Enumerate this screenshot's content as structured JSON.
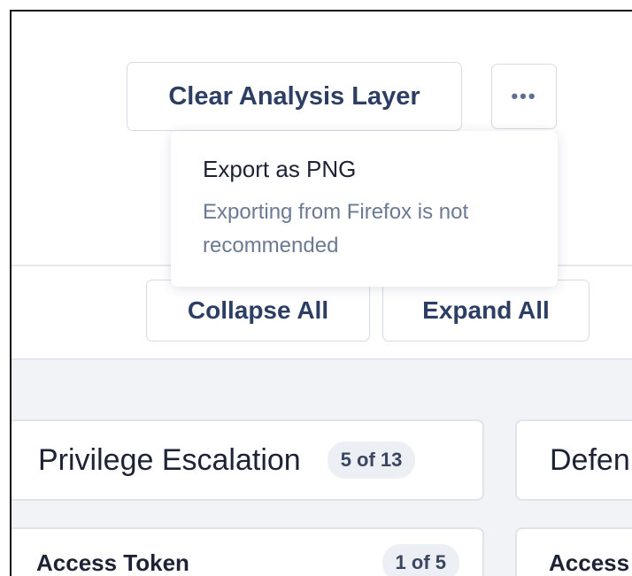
{
  "toolbar": {
    "clear_label": "Clear Analysis Layer",
    "more_label": "•••",
    "collapse_label": "Collapse All",
    "expand_label": "Expand All"
  },
  "menu": {
    "export_png": "Export as PNG",
    "export_note": "Exporting from Firefox is not recommended"
  },
  "columns": [
    {
      "title": "Privilege Escalation",
      "count": "5 of 13",
      "row_title": "Access Token",
      "row_count": "1 of 5"
    },
    {
      "title": "Defen",
      "row_title": "Access"
    }
  ]
}
